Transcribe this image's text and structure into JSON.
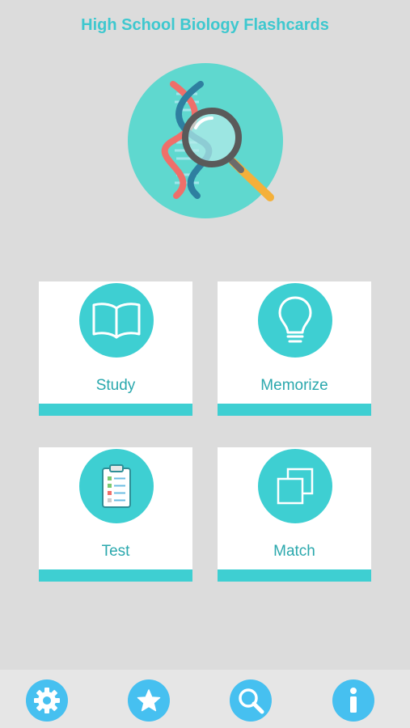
{
  "app": {
    "title": "High School Biology Flashcards"
  },
  "logo": {
    "icon": "dna-magnifier-icon"
  },
  "menu": [
    {
      "id": "study",
      "label": "Study",
      "icon": "open-book-icon"
    },
    {
      "id": "memorize",
      "label": "Memorize",
      "icon": "lightbulb-icon"
    },
    {
      "id": "test",
      "label": "Test",
      "icon": "clipboard-checklist-icon"
    },
    {
      "id": "match",
      "label": "Match",
      "icon": "overlapping-squares-icon"
    }
  ],
  "tabbar": [
    {
      "id": "settings",
      "icon": "gear-icon"
    },
    {
      "id": "favorites",
      "icon": "star-icon"
    },
    {
      "id": "search",
      "icon": "search-icon"
    },
    {
      "id": "info",
      "icon": "info-icon"
    }
  ],
  "colors": {
    "background": "#dcdcdc",
    "accent": "#3ecfd2",
    "title": "#3ec8cf",
    "tab_icon": "#46c0f0",
    "card": "#ffffff"
  }
}
